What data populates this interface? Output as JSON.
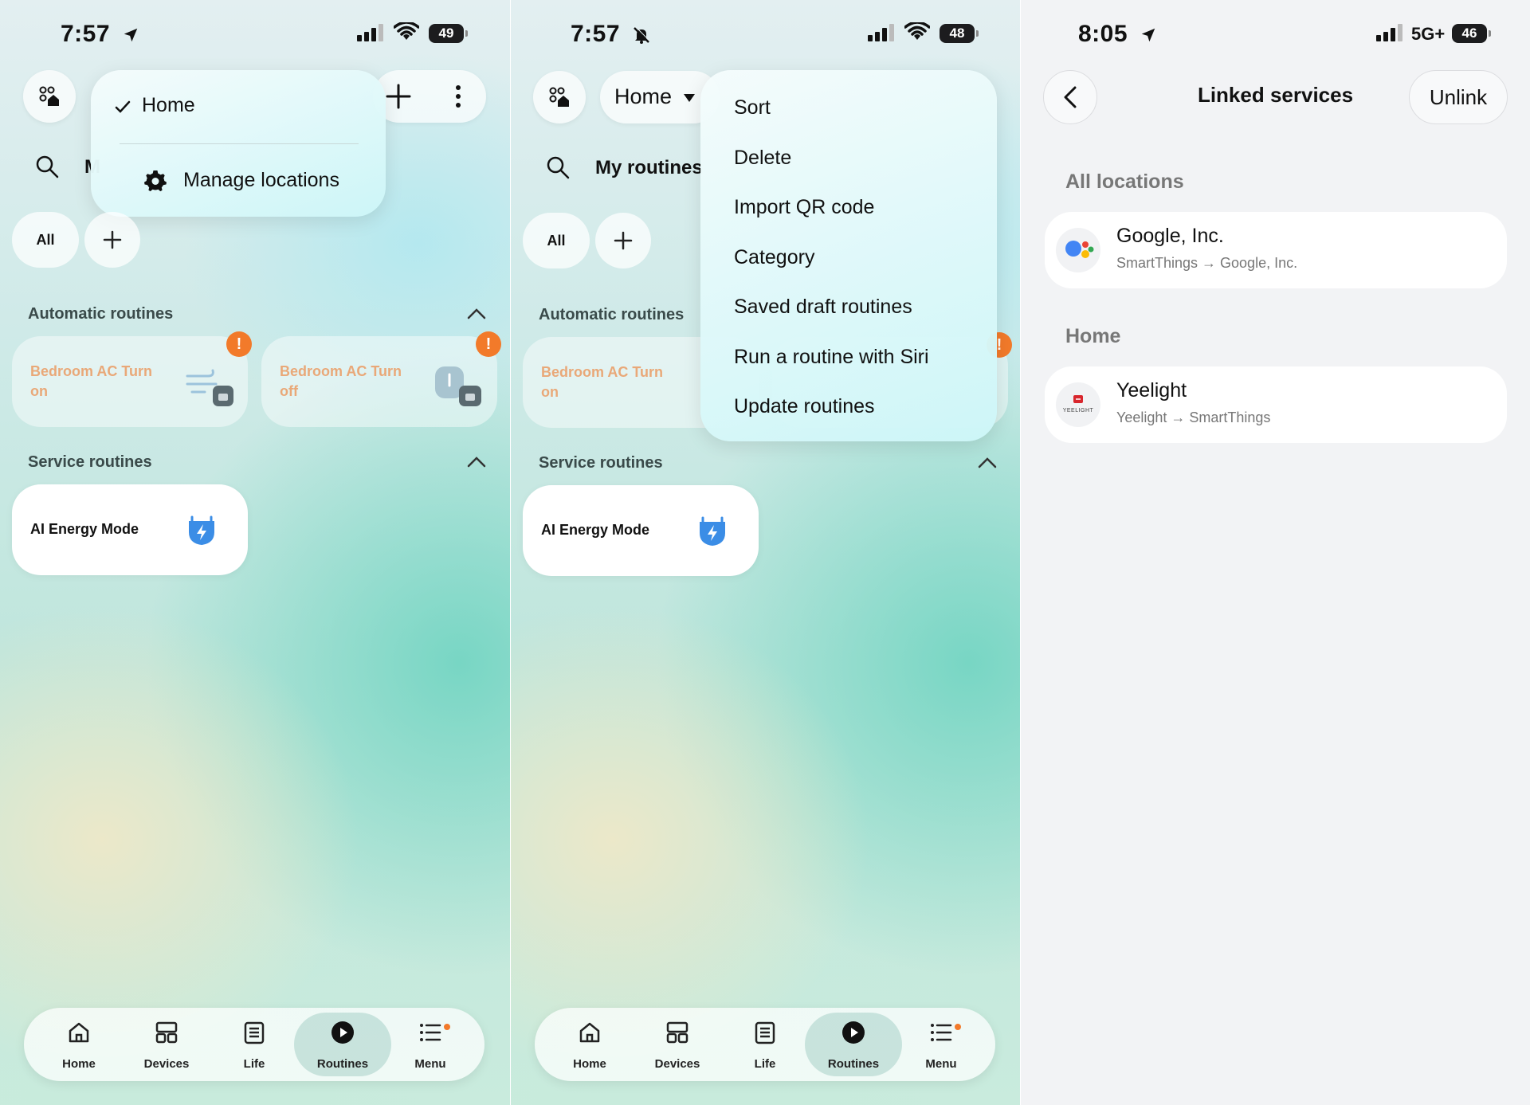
{
  "panel1": {
    "status": {
      "time": "7:57",
      "battery": "49",
      "time_icon": "location-arrow-icon"
    },
    "location_menu": {
      "selected": "Home",
      "manage": "Manage locations"
    },
    "filters": {
      "all": "All"
    },
    "search_title_partial": "M",
    "automatic_title": "Automatic routines",
    "automatic_cards": [
      {
        "label": "Bedroom AC Turn on"
      },
      {
        "label": "Bedroom AC Turn off"
      }
    ],
    "service_title": "Service routines",
    "service_cards": [
      {
        "label": "AI Energy Mode"
      }
    ],
    "warn_mark": "!"
  },
  "panel2": {
    "status": {
      "time": "7:57",
      "battery": "48",
      "time_icon": "bell-muted-icon"
    },
    "location": "Home",
    "title": "My routines",
    "filters": {
      "all": "All"
    },
    "more_menu": [
      "Sort",
      "Delete",
      "Import QR code",
      "Category",
      "Saved draft routines",
      "Run a routine with Siri",
      "Update routines"
    ],
    "automatic_title": "Automatic routines",
    "automatic_cards": [
      {
        "label": "Bedroom AC Turn on"
      }
    ],
    "service_title": "Service routines",
    "service_cards": [
      {
        "label": "AI Energy Mode"
      }
    ],
    "warn_mark": "!"
  },
  "nav": [
    {
      "label": "Home",
      "icon": "home-icon"
    },
    {
      "label": "Devices",
      "icon": "devices-icon"
    },
    {
      "label": "Life",
      "icon": "life-icon"
    },
    {
      "label": "Routines",
      "icon": "play-icon"
    },
    {
      "label": "Menu",
      "icon": "menu-icon"
    }
  ],
  "panel3": {
    "status": {
      "time": "8:05",
      "battery": "46",
      "network": "5G+"
    },
    "title": "Linked services",
    "unlink": "Unlink",
    "sections": [
      {
        "title": "All locations",
        "services": [
          {
            "name": "Google, Inc.",
            "flow": "SmartThings → Google, Inc."
          }
        ]
      },
      {
        "title": "Home",
        "services": [
          {
            "name": "Yeelight",
            "flow": "Yeelight → SmartThings",
            "logo_text": "YEELIGHT"
          }
        ]
      }
    ]
  },
  "colors": {
    "accent_warn": "#f27a2a",
    "card_orange_text": "#e9a878",
    "energy_blue": "#3b8de6"
  }
}
